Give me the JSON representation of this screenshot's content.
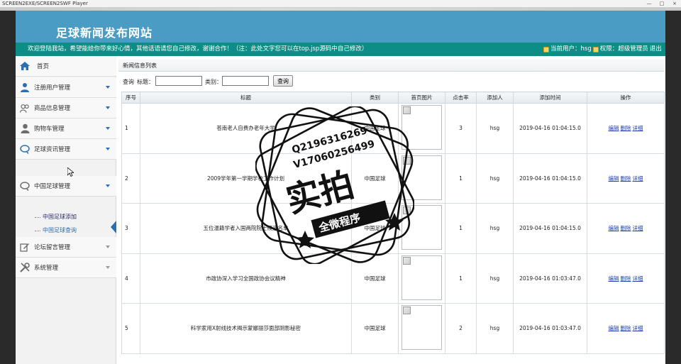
{
  "player": {
    "title": "SCREEN2EXE/SCREEN2SWF Player",
    "min": "—",
    "max": "□",
    "close": "×"
  },
  "header": {
    "site_title": "足球新闻发布网站"
  },
  "topbar": {
    "welcome": "欢迎登陆我站，希望能给你带来好心情，其他话语请您自己修改，谢谢合作！（注：此处文字您可以在top.jsp源码中自己修改）",
    "current_user": "当前用户：hsg",
    "permission": "权限：超级管理员",
    "logout": "退出"
  },
  "sidebar": {
    "home": "首页",
    "items": [
      {
        "label": "注册用户管理",
        "icon": "people-icon"
      },
      {
        "label": "商品信息管理",
        "icon": "group-icon"
      },
      {
        "label": "购物车管理",
        "icon": "person-icon"
      },
      {
        "label": "足球资讯管理",
        "icon": "chat-icon"
      },
      {
        "label": "中国足球管理",
        "icon": "chat-icon"
      },
      {
        "label": "论坛留言管理",
        "icon": "edit-icon"
      },
      {
        "label": "系统管理",
        "icon": "tools-icon"
      }
    ],
    "sub_items": [
      "中国足球添加",
      "中国足球查询"
    ]
  },
  "main": {
    "crumb": "新闻信息列表",
    "search": {
      "query_label": "查询",
      "title_label": "标题：",
      "category_label": "类别：",
      "title_value": "",
      "category_value": "",
      "button": "查询"
    },
    "columns": [
      "序号",
      "标题",
      "类别",
      "首页图片",
      "点击率",
      "添加人",
      "添加时间",
      "操作"
    ],
    "rows": [
      {
        "no": "1",
        "title": "苍南老人自费办老年大学",
        "category": "中国足球",
        "clicks": "3",
        "adder": "hsg",
        "time": "2019-04-16 01:04:15.0"
      },
      {
        "no": "2",
        "title": "2009学年第一学期学校工作计划",
        "category": "中国足球",
        "clicks": "1",
        "adder": "hsg",
        "time": "2019-04-16 01:04:15.0"
      },
      {
        "no": "3",
        "title": "五位温籍学者入国两院院士候选名单",
        "category": "中国足球",
        "clicks": "1",
        "adder": "hsg",
        "time": "2019-04-16 01:04:15.0"
      },
      {
        "no": "4",
        "title": "市政协深入学习全国政协会议精神",
        "category": "中国足球",
        "clicks": "1",
        "adder": "hsg",
        "time": "2019-04-16 01:03:47.0"
      },
      {
        "no": "5",
        "title": "科学家用X射线技术揭示蒙娜丽莎面部阴影秘密",
        "category": "中国足球",
        "clicks": "2",
        "adder": "hsg",
        "time": "2019-04-16 01:03:47.0"
      }
    ],
    "ops": {
      "edit": "编辑",
      "delete": "删除",
      "detail": "详细"
    }
  },
  "watermark": {
    "line1": "Q2196316269",
    "line2": "V17060256499",
    "big": "实拍",
    "banner": "全微程序"
  }
}
